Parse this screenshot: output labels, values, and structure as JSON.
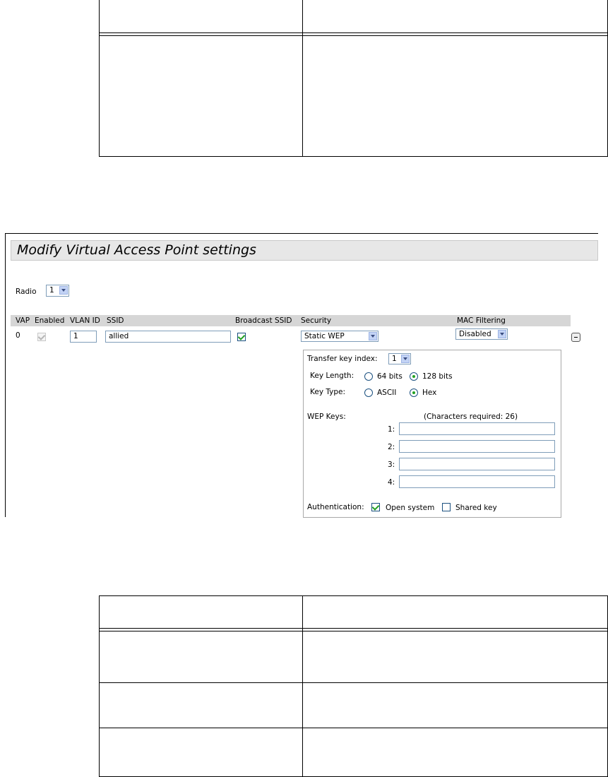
{
  "panel": {
    "title": "Modify Virtual Access Point settings",
    "radio_label": "Radio",
    "radio_value": "1"
  },
  "vap_table": {
    "headers": {
      "vap": "VAP",
      "enabled": "Enabled",
      "vlan_id": "VLAN ID",
      "ssid": "SSID",
      "broadcast_ssid": "Broadcast SSID",
      "security": "Security",
      "mac_filtering": "MAC Filtering"
    },
    "row": {
      "vap": "0",
      "enabled": true,
      "vlan_id": "1",
      "ssid": "allied",
      "broadcast_ssid": true,
      "security": "Static WEP",
      "mac_filtering": "Disabled"
    }
  },
  "wep": {
    "transfer_key_index_label": "Transfer key index:",
    "transfer_key_index_value": "1",
    "key_length_label": "Key Length:",
    "key_length_64": "64 bits",
    "key_length_128": "128 bits",
    "key_length_selected": "128 bits",
    "key_type_label": "Key Type:",
    "key_type_ascii": "ASCII",
    "key_type_hex": "Hex",
    "key_type_selected": "Hex",
    "wep_keys_label": "WEP Keys:",
    "chars_required": "(Characters required: 26)",
    "keys": [
      {
        "label": "1:",
        "value": ""
      },
      {
        "label": "2:",
        "value": ""
      },
      {
        "label": "3:",
        "value": ""
      },
      {
        "label": "4:",
        "value": ""
      }
    ],
    "authentication_label": "Authentication:",
    "open_system_label": "Open system",
    "open_system_checked": true,
    "shared_key_label": "Shared key",
    "shared_key_checked": false
  },
  "colors": {
    "banner_bg": "#e7e7e7",
    "header_bar_bg": "#d6d6d6",
    "check_green": "#21a121"
  }
}
